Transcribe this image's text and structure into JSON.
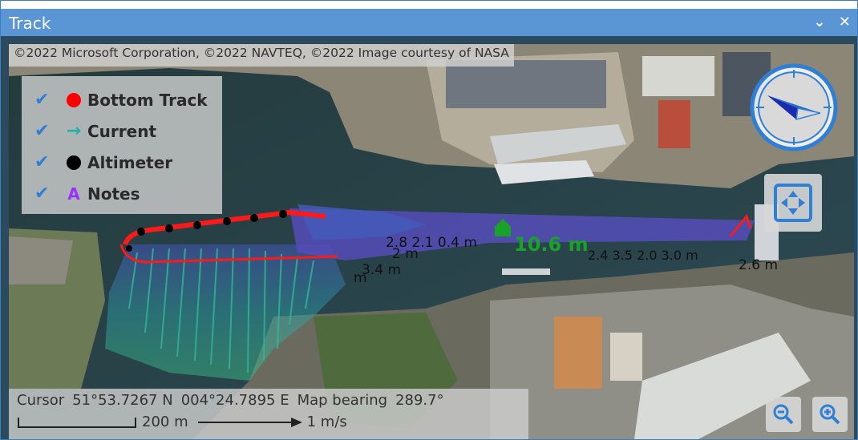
{
  "window": {
    "title": "Track",
    "collapse_glyph": "⌄",
    "close_glyph": "✕"
  },
  "map": {
    "attribution": "©2022 Microsoft Corporation, ©2022 NAVTEQ, ©2022 Image courtesy of NASA",
    "legend": [
      {
        "label": "Bottom Track",
        "checked": true,
        "symbol": "red-dot",
        "color": "#ff0000"
      },
      {
        "label": "Current",
        "checked": true,
        "symbol": "arrow",
        "color": "#20b2aa",
        "glyph": "→"
      },
      {
        "label": "Altimeter",
        "checked": true,
        "symbol": "black-dot",
        "color": "#000000"
      },
      {
        "label": "Notes",
        "checked": true,
        "symbol": "letter-a",
        "color": "#9b30ff",
        "glyph": "A"
      }
    ],
    "check_glyph": "✔",
    "track_labels": {
      "depth_main": "10.6 m",
      "depth_small_1": "2 m",
      "depth_small_2": "3.4 m",
      "depth_small_3": "m",
      "depth_right": "2.6 m",
      "cluttered_1": "2.8 2.1 0.4 m",
      "cluttered_2": "2.4 3.5 2.0 3.0 m"
    },
    "status": {
      "cursor_label": "Cursor",
      "cursor_lat": "51°53.7267 N",
      "cursor_lon": "004°24.7895 E",
      "bearing_label": "Map bearing",
      "bearing_value": "289.7°",
      "scale_distance": "200 m",
      "scale_speed": "1 m/s"
    },
    "colors": {
      "accent": "#2f7fd6",
      "titlebar": "#5a95d6",
      "bottom_track": "#ff0000",
      "depth_label": "#1aa12a"
    }
  }
}
